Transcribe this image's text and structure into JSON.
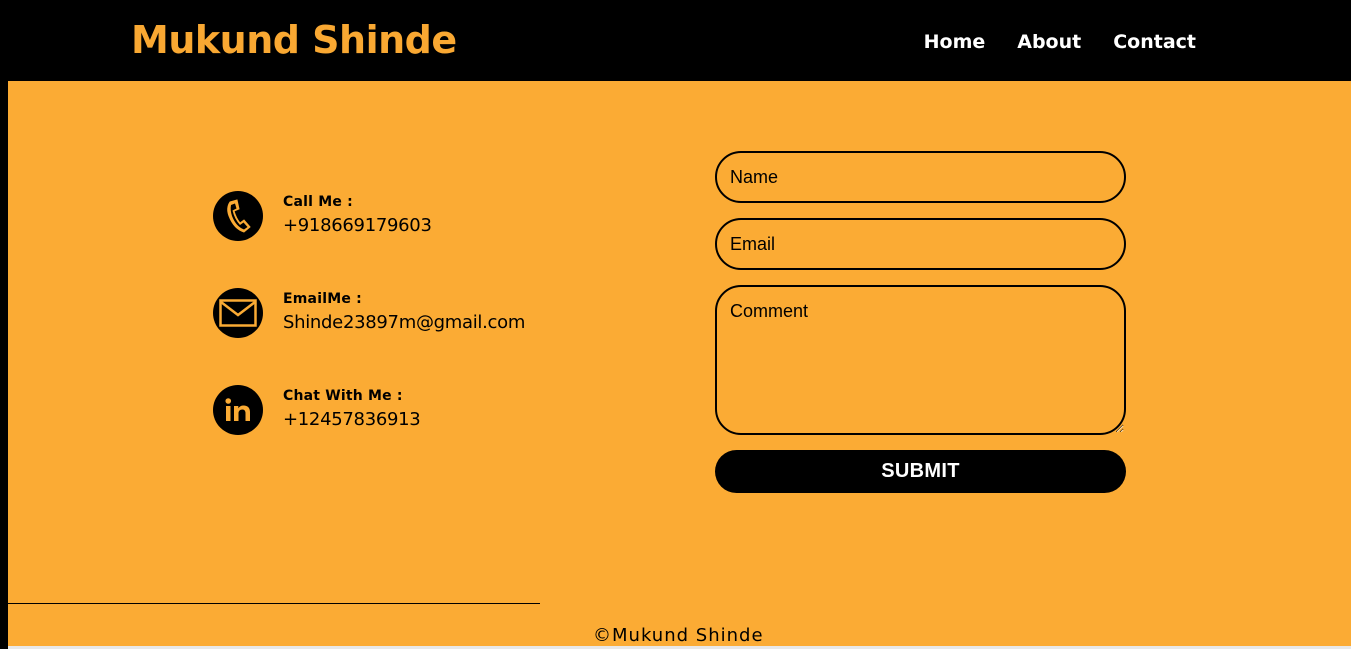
{
  "header": {
    "brand": "Mukund Shinde",
    "nav": [
      "Home",
      "About",
      "Contact"
    ]
  },
  "contact_info": [
    {
      "icon": "phone-icon",
      "title": "Call Me :",
      "value": "+918669179603"
    },
    {
      "icon": "mail-icon",
      "title": "EmailMe :",
      "value": "Shinde23897m@gmail.com"
    },
    {
      "icon": "linkedin-icon",
      "title": "Chat With Me :",
      "value": "+12457836913"
    }
  ],
  "form": {
    "name_placeholder": "Name",
    "email_placeholder": "Email",
    "comment_placeholder": "Comment",
    "submit_label": "SUBMIT"
  },
  "footer": {
    "copyright": "©Mukund Shinde"
  },
  "colors": {
    "accent": "#fbab34",
    "brand_text": "#f9a832",
    "dark": "#000000"
  }
}
